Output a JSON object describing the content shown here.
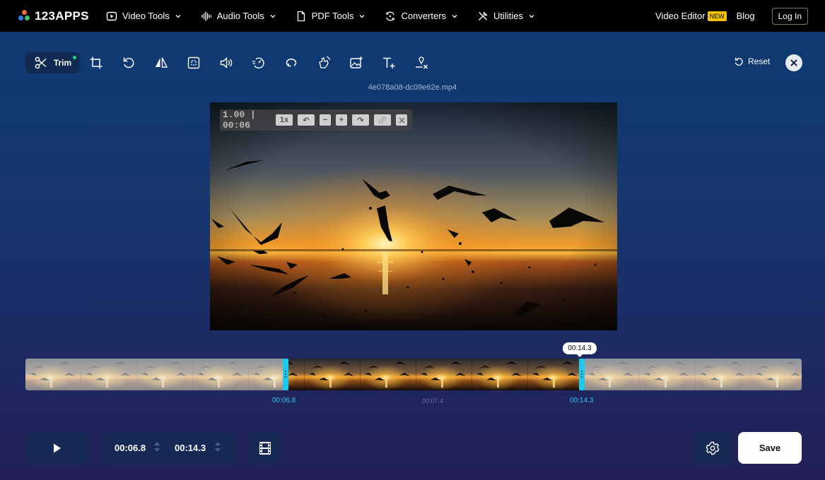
{
  "brand": {
    "name": "123APPS",
    "dot_colors": [
      "#f26b3a",
      "#2b7de9",
      "#35c46b",
      "#f7c600"
    ]
  },
  "nav": {
    "items": [
      {
        "label": "Video Tools",
        "icon": "play-square-icon"
      },
      {
        "label": "Audio Tools",
        "icon": "waveform-icon"
      },
      {
        "label": "PDF Tools",
        "icon": "document-icon"
      },
      {
        "label": "Converters",
        "icon": "convert-icon"
      },
      {
        "label": "Utilities",
        "icon": "tools-icon"
      }
    ],
    "video_editor_label": "Video Editor",
    "new_badge": "NEW",
    "blog_label": "Blog",
    "login_label": "Log In"
  },
  "toolbar": {
    "active_label": "Trim",
    "tools": [
      "scissors-icon",
      "crop-icon",
      "rotate-icon",
      "flip-icon",
      "resize-icon",
      "volume-icon",
      "speed-icon",
      "loop-icon",
      "stabilize-icon",
      "image-icon",
      "text-icon",
      "remove-logo-icon"
    ],
    "reset_label": "Reset"
  },
  "file": {
    "name": "4e078a08-dc09e62e.mp4"
  },
  "player": {
    "speed_readout": "1.00 | 00:06",
    "speed_button": "1x",
    "buttons": [
      "↶",
      "−",
      "+",
      "↷"
    ]
  },
  "timeline": {
    "bubble": "00:14.3",
    "start_label": "00:06.8",
    "mid_label": "00:07.4",
    "end_label": "00:14.3"
  },
  "controls": {
    "start_time": "00:06.8",
    "end_time": "00:14.3",
    "save_label": "Save"
  },
  "colors": {
    "accent": "#1cc8ee",
    "active_dot": "#21d07a",
    "new_badge": "#f7c600"
  }
}
